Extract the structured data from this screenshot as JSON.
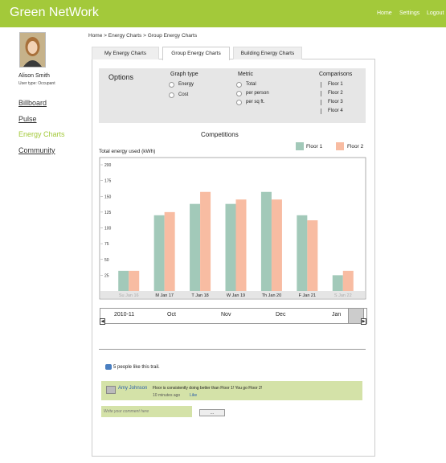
{
  "header": {
    "brand": "Green NetWork",
    "nav": [
      "Home",
      "Settings",
      "Logout"
    ]
  },
  "user": {
    "name": "Alison Smith",
    "type_label": "User type:",
    "type_value": "Occupant"
  },
  "sidebar": {
    "items": [
      {
        "label": "Billboard",
        "active": false
      },
      {
        "label": "Pulse",
        "active": false
      },
      {
        "label": "Energy Charts",
        "active": true
      },
      {
        "label": "Community",
        "active": false
      }
    ]
  },
  "breadcrumb": "Home > Energy Charts > Group Energy Charts",
  "tabs": [
    {
      "label": "My Energy Charts",
      "active": false
    },
    {
      "label": "Group Energy Charts",
      "active": true
    },
    {
      "label": "Building Energy Charts",
      "active": false
    }
  ],
  "options": {
    "title": "Options",
    "graph_type": {
      "label": "Graph type",
      "items": [
        "Energy",
        "Cost"
      ]
    },
    "metric": {
      "label": "Metric",
      "items": [
        "Total",
        "per person",
        "per sq ft."
      ]
    },
    "comparisons": {
      "label": "Comparisons",
      "items": [
        "Floor 1",
        "Floor 2",
        "Floor 3",
        "Floor 4"
      ]
    }
  },
  "chart_title": "Competitions",
  "colors": {
    "floor1": "#a2c9b9",
    "floor2": "#f8bca2",
    "brand": "#a3c93a"
  },
  "chart_data": {
    "type": "bar",
    "ylabel": "Total energy used (kWh)",
    "ylim": [
      0,
      200
    ],
    "yticks": [
      25,
      50,
      75,
      100,
      125,
      150,
      175,
      200
    ],
    "categories": [
      "Su Jan 16",
      "M Jan 17",
      "T Jan 18",
      "W Jan 19",
      "Th Jan 20",
      "F Jan 21",
      "S Jan 22"
    ],
    "series": [
      {
        "name": "Floor 1",
        "values": [
          32,
          120,
          138,
          138,
          157,
          120,
          25
        ]
      },
      {
        "name": "Floor 2",
        "values": [
          32,
          125,
          157,
          145,
          145,
          112,
          32
        ]
      }
    ],
    "legend": "top-right"
  },
  "timeline": {
    "labels": [
      "2010-11",
      "Oct",
      "Nov",
      "Dec",
      "Jan"
    ]
  },
  "social": {
    "likes": "5 people like this trail.",
    "comment": {
      "author": "Amy Johnson",
      "text": "Floor is consistently doing better than Floor 1! You go Floor 2!",
      "time": "10 minutes ago",
      "like": "Like"
    },
    "input_placeholder": "Write your comment here",
    "submit_label": "..."
  }
}
